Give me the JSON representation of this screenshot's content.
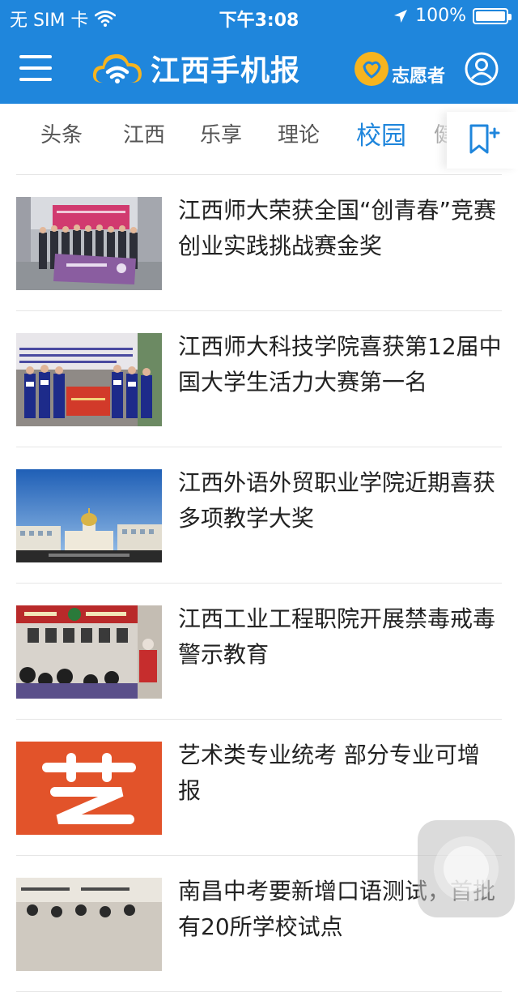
{
  "status": {
    "carrier": "无 SIM 卡",
    "time": "下午3:08",
    "battery": "100%",
    "battery_level": 1.0
  },
  "header": {
    "logo_text": "江西手机报",
    "volunteer_label": "志愿者"
  },
  "tabs": [
    {
      "label": "头条",
      "active": false
    },
    {
      "label": "江西",
      "active": false
    },
    {
      "label": "乐享",
      "active": false
    },
    {
      "label": "理论",
      "active": false
    },
    {
      "label": "校园",
      "active": true
    },
    {
      "label": "健",
      "active": false
    }
  ],
  "news": [
    {
      "title": "江西师大荣获全国“创青春”竞赛创业实践挑战赛金奖"
    },
    {
      "title": "江西师大科技学院喜获第12届中国大学生活力大赛第一名"
    },
    {
      "title": "江西外语外贸职业学院近期喜获多项教学大奖"
    },
    {
      "title": "江西工业工程职院开展禁毒戒毒警示教育"
    },
    {
      "title": "艺术类专业统考 部分专业可增报",
      "thumb_glyph": "艺"
    },
    {
      "title": "南昌中考要新增口语测试，首批有20所学校试点"
    }
  ],
  "colors": {
    "brand_blue": "#1f86dc",
    "logo_yellow": "#f6b41f",
    "art_orange": "#e2532a"
  }
}
